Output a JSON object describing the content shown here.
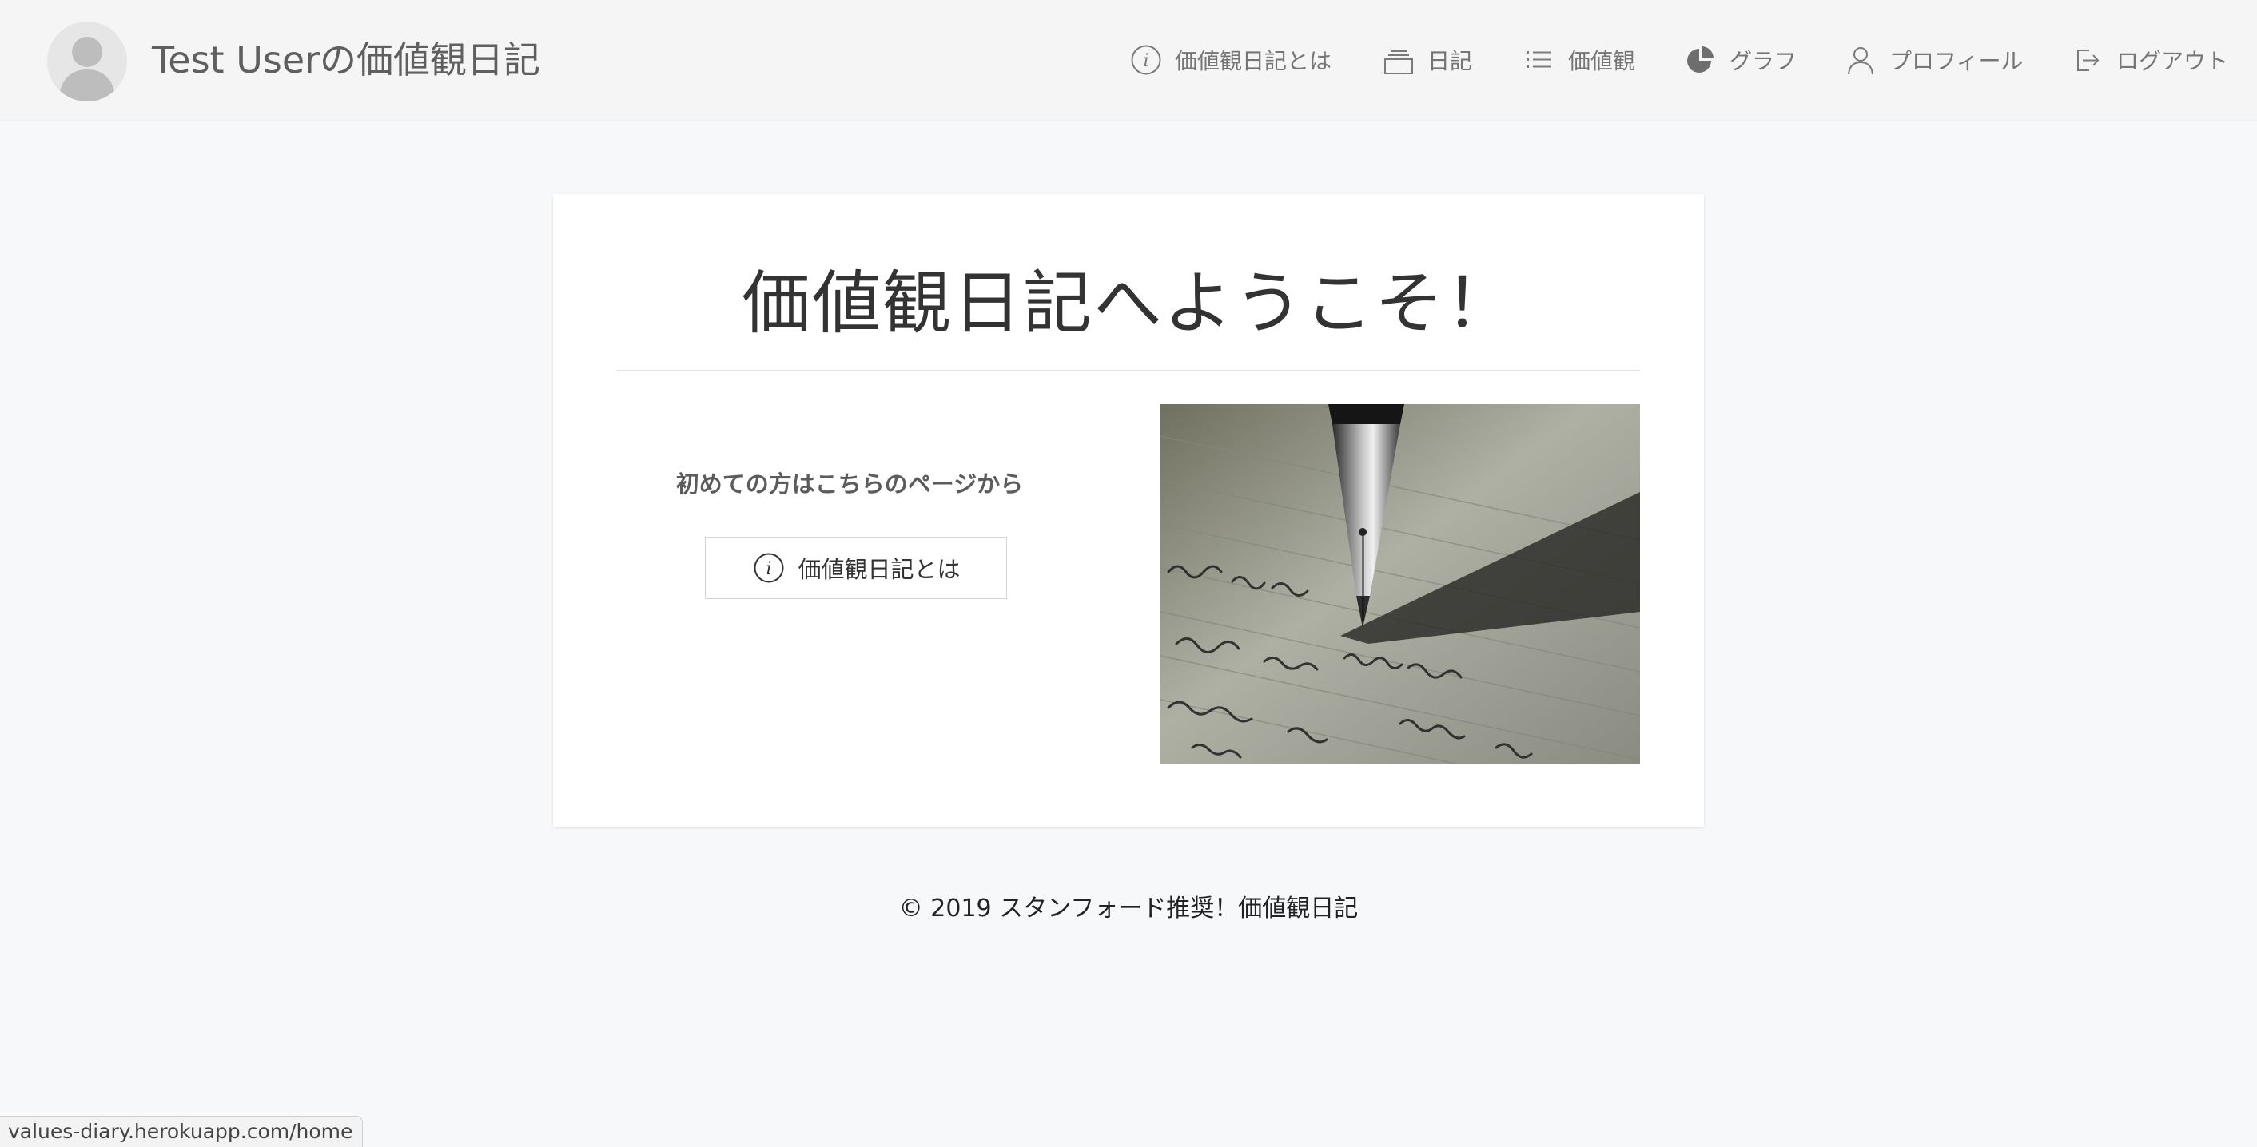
{
  "header": {
    "site_title": "Test Userの価値観日記",
    "nav": {
      "about": "価値観日記とは",
      "diary": "日記",
      "values": "価値観",
      "graph": "グラフ",
      "profile": "プロフィール",
      "logout": "ログアウト"
    },
    "icons": {
      "about": "info-circle-icon",
      "diary": "stacked-box-icon",
      "values": "list-icon",
      "graph": "pie-chart-icon",
      "profile": "user-icon",
      "logout": "logout-icon"
    }
  },
  "main": {
    "welcome_title": "価値観日記へようこそ！",
    "intro_label": "初めての方はこちらのページから",
    "about_button_label": "価値観日記とは",
    "photo": "fountain-pen-writing-photo"
  },
  "footer": {
    "copyright": "© 2019 スタンフォード推奨！価値観日記"
  },
  "status_bar": {
    "url": "values-diary.herokuapp.com/home"
  },
  "colors": {
    "page_bg": "#f7f8fa",
    "header_bg": "#f5f5f5",
    "card_bg": "#ffffff",
    "nav_text": "#767676"
  }
}
